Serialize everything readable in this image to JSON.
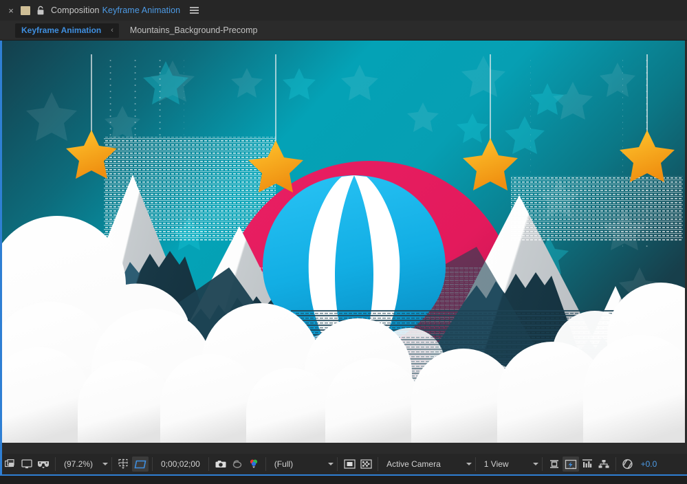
{
  "window": {
    "close_label": "×",
    "swatch_color": "#cfbe96",
    "lock_icon": "lock-icon",
    "panel_type": "Composition",
    "comp_name": "Keyframe Animation",
    "menu_icon": "panel-menu-icon"
  },
  "tabs": {
    "active_tab": "Keyframe Animation",
    "back_chevron": "‹",
    "breadcrumb": "Mountains_Background-Precomp"
  },
  "toolbar": {
    "always_preview_this_view": "always-preview-this-view-icon",
    "main_view": "main-viewer-icon",
    "3d_glasses": "3d-view-glasses-icon",
    "magnification": "(97.2%)",
    "magnification_caret": "chevron-down-icon",
    "choose_grid": "choose-grid-and-guide-options-icon",
    "region_of_interest": "region-of-interest-icon",
    "timecode": "0;00;02;00",
    "snapshot": "take-snapshot-icon",
    "show_snapshot": "show-last-snapshot-icon",
    "show_channel": "show-channel-rgb-icon",
    "resolution": "(Full)",
    "resolution_caret": "chevron-down-icon",
    "toggle_mask": "toggle-mask-and-shape-path-visibility-icon",
    "toggle_transparency_grid": "toggle-transparency-grid-icon",
    "camera": "Active Camera",
    "camera_caret": "chevron-down-icon",
    "views": "1 View",
    "views_caret": "chevron-down-icon",
    "pixel_aspect": "toggle-pixel-aspect-ratio-correction-icon",
    "fast_previews": "fast-previews-icon",
    "timeline": "timeline-icon",
    "comp_flowchart": "comp-flowchart-icon",
    "exposure_icon": "reset-exposure-icon",
    "exposure_value": "+0.0"
  },
  "colors": {
    "accent_blue": "#2f7fd4",
    "link_blue": "#4d9be6",
    "sky_dark": "#134b56",
    "sky_bright": "#00a7bb",
    "sun_pink": "#e0245e",
    "star_gold": "#f7a81b",
    "mountain_navy": "#1d3c4d",
    "mountain_slate": "#2d5d73",
    "mountain_grey": "#c8cdd0",
    "snow_white": "#ffffff",
    "balloon_cyan": "#19b5e8",
    "basket_gold": "#cc8d18"
  },
  "artwork": {
    "title": "Mountains, hot air balloon and clouds paper-cut illustration",
    "hanging_stars": 4,
    "background_star_count": 18,
    "mountain_count": 6,
    "cloud_rows": 3
  }
}
